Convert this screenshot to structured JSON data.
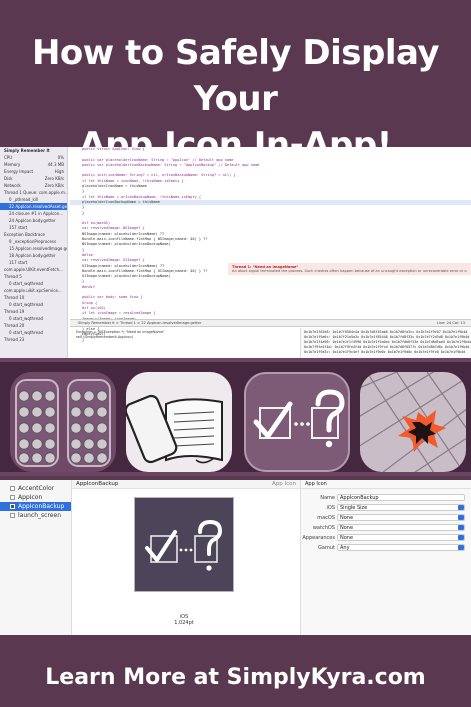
{
  "page": {
    "title_line1": "How to Safely Display Your",
    "title_line2": "App Icon In-App!",
    "footer": "Learn More at SimplyKyra.com",
    "bg": "#5a3850"
  },
  "xcode": {
    "navigator": {
      "app_name": "Simply Remember It",
      "gauges": [
        {
          "label": "CPU",
          "value": "0%"
        },
        {
          "label": "Memory",
          "value": "44.3 MB"
        },
        {
          "label": "Energy Impact",
          "value": "High"
        },
        {
          "label": "Disk",
          "value": "Zero KB/s"
        },
        {
          "label": "Network",
          "value": "Zero KB/s"
        }
      ],
      "threads": [
        "Thread 1 Queue: com.apple.m...",
        "0 _pthread_kill",
        "22 AppIcon.resolvedAsset.getter",
        "24 closure #1 in AppIcon...",
        "24 AppIcon.body.getter",
        "157 start",
        "Exception Backtrace",
        "9 _exceptionPreprocess",
        "15 AppIcon.resolvedImage.getter",
        "18 AppIcon.body.getter",
        "117 start",
        "com.apple.UIKit.eventFetch...",
        "Thread 5",
        "0 start_wqthread",
        "com.apple.uikit.xpcService...",
        "Thread 10",
        "0 start_wqthread",
        "Thread 19",
        "0 start_wqthread",
        "Thread 20",
        "0 start_wqthread",
        "Thread 23"
      ],
      "selected_thread_index": 2
    },
    "code_lines": [
      "public struct AppIcon: View {",
      "",
      "    public var placeholderIconName: String = \"AppIcon\" // Default app name",
      "    public var placeholderIconBackupName: String = \"AppIconBackup\" // Default app name",
      "",
      "    public init(iconName: String? = nil, orIconBackupName: String? = nil) {",
      "        if let thisName = iconName, !thisName.isEmpty {",
      "            placeholderIconName = thisName",
      "        }",
      "        if let thisName = orIconBackupName, !thisName.isEmpty {",
      "            placeholderIconBackupName = thisName",
      "        }",
      "    }",
      "",
      "#if os(macOS)",
      "    var resolvedImage: NSImage? {",
      "        NSImage(named: placeholderIconName) ??",
      "        Bundle.main.iconFileName.flatMap { NSImage(named: $0) } ??",
      "        NSImage(named: placeholderIconBackupName)",
      "    }",
      "#else",
      "    var resolvedImage: UIImage? {",
      "        UIImage(named: placeholderIconName) ??",
      "        Bundle.main.iconFileName.flatMap { UIImage(named: $0) } ??",
      "        UIImage(named: placeholderIconBackupName)",
      "    }",
      "#endif",
      "",
      "    public var body: some View {",
      "        Group {",
      "#if os(iOS)",
      "            if let iconImage = resolvedImage {",
      "                Image(uiImage: iconImage)",
      "                    .cornerRadius(10.0)",
      "            } else {",
      "                EmptyView()",
      "            }"
    ],
    "highlight_line_index": 10,
    "error": {
      "title": "Thread 1: \"Need an imageName\"",
      "detail": "An abort signal terminated the process. Such crashes often happen because of an uncaught exception or unrecoverable error or calling the abort() function."
    },
    "status_bar": "Simply Remember It  >  Thread 1  >  22 AppIcon.resolvedImage.getter",
    "line_col": "Line: 24  Col: 13",
    "debug_lines": [
      "Exception = (NSException *) \"Need an imageName\"",
      "self (SimplyRememberIt.AppIcon)"
    ],
    "memory_lines": [
      "0x1b7e1f63d8: 0x1b7f0584c4a 0x1b7d8f45ab8 0x1b7d8fa3cc 0x1b7e1f9c07 0x1b7e1f9b4d",
      "0x1b7e1f9a6c: 0x1b7f21a5a3c 0x1b7e1f85448 0x1b7fd8f33c 0x1b7e7f2d3d8 0x1b7e1f9b4d",
      "0x1b7e1f4a96: 0x1b7e1f1f4998 0x1b7e1f5a0ac 0x1b7fdb8f23e 0x1b7d8d5ad4 0x1b7e1f9b4d",
      "0x1b7f9fe4f4d: 0x1b7f9fe4f4d 0x1b7e1f9fcd 0x1b7d8f6577c 0x1b7d8b7d8c 0x1b7e1f9b4d",
      "0x1b7e1f9a3c: 0x1b7e1f9c4ef 0x1b7e1f9d0c 0x1b7e1f9d0c 0x1b7e1f9fc0 0x1b7e1f9b4d"
    ]
  },
  "icon_strip": {
    "icons": [
      {
        "name": "emoji-grid-app-icon"
      },
      {
        "name": "book-and-phone-app-icon"
      },
      {
        "name": "check-question-app-icon"
      },
      {
        "name": "broken-tile-app-icon"
      }
    ]
  },
  "assets": {
    "items": [
      {
        "label": "AccentColor",
        "selected": false
      },
      {
        "label": "AppIcon",
        "selected": false
      },
      {
        "label": "AppIconBackup",
        "selected": true
      },
      {
        "label": "launch_screen",
        "selected": false
      }
    ],
    "header_title": "AppIconBackup",
    "header_right": "App Icon",
    "well_caption_platform": "iOS",
    "well_caption_size": "1,024pt",
    "inspector": {
      "title": "App Icon",
      "fields": [
        {
          "label": "Name",
          "value": "AppIconBackup",
          "popup": false
        },
        {
          "label": "iOS",
          "value": "Single Size",
          "popup": true
        },
        {
          "label": "macOS",
          "value": "None",
          "popup": true
        },
        {
          "label": "watchOS",
          "value": "None",
          "popup": true
        },
        {
          "label": "Appearances",
          "value": "None",
          "popup": true
        },
        {
          "label": "Gamut",
          "value": "Any",
          "popup": true
        }
      ]
    }
  }
}
